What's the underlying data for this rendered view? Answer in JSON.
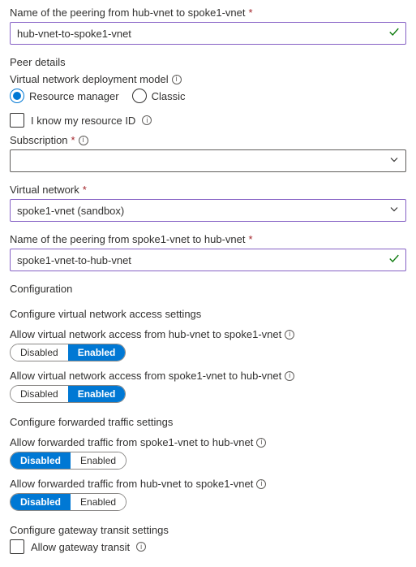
{
  "peering_name_hub_to_spoke": {
    "label": "Name of the peering from hub-vnet to spoke1-vnet",
    "value": "hub-vnet-to-spoke1-vnet",
    "required": true
  },
  "peer_details": {
    "title": "Peer details",
    "deployment_model": {
      "label": "Virtual network deployment model",
      "options": {
        "rm": "Resource manager",
        "classic": "Classic"
      },
      "selected": "rm"
    },
    "know_resource_id": {
      "label": "I know my resource ID",
      "checked": false
    }
  },
  "subscription": {
    "label": "Subscription",
    "required": true,
    "value": ""
  },
  "virtual_network": {
    "label": "Virtual network",
    "required": true,
    "value": "spoke1-vnet (sandbox)"
  },
  "peering_name_spoke_to_hub": {
    "label": "Name of the peering from spoke1-vnet to hub-vnet",
    "value": "spoke1-vnet-to-hub-vnet",
    "required": true
  },
  "configuration": {
    "title": "Configuration",
    "access_title": "Configure virtual network access settings",
    "access_hub_to_spoke": {
      "label": "Allow virtual network access from hub-vnet to spoke1-vnet",
      "value": "Enabled"
    },
    "access_spoke_to_hub": {
      "label": "Allow virtual network access from spoke1-vnet to hub-vnet",
      "value": "Enabled"
    },
    "forwarded_title": "Configure forwarded traffic settings",
    "forwarded_spoke_to_hub": {
      "label": "Allow forwarded traffic from spoke1-vnet to hub-vnet",
      "value": "Disabled"
    },
    "forwarded_hub_to_spoke": {
      "label": "Allow forwarded traffic from hub-vnet to spoke1-vnet",
      "value": "Disabled"
    },
    "gateway_title": "Configure gateway transit settings",
    "gateway_transit": {
      "label": "Allow gateway transit",
      "checked": false
    },
    "toggle_options": {
      "disabled": "Disabled",
      "enabled": "Enabled"
    }
  },
  "icons": {
    "required_mark": "*"
  }
}
